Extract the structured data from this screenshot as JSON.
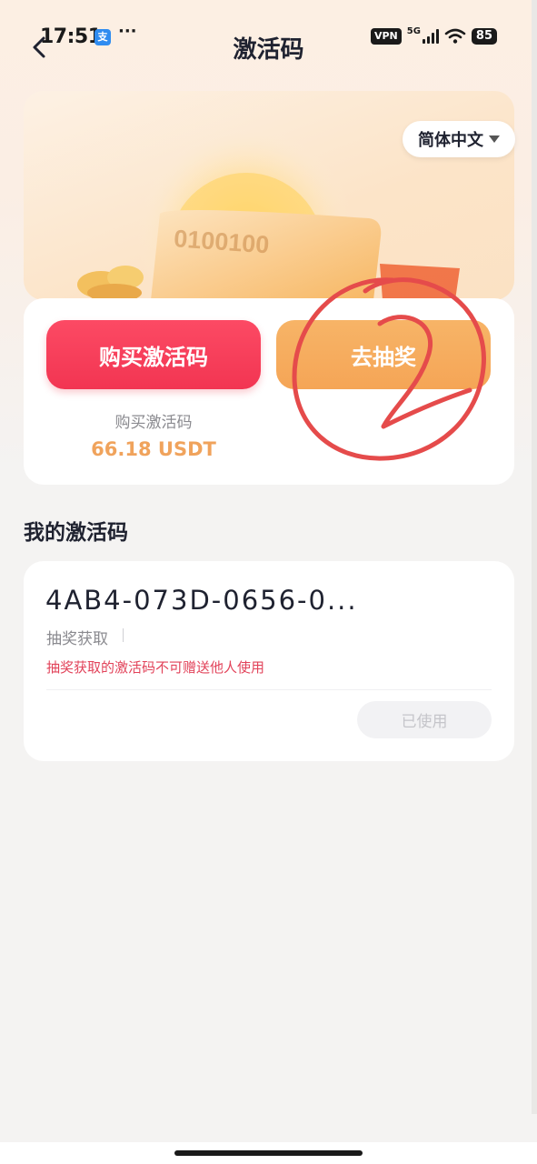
{
  "status_bar": {
    "time": "17:51",
    "app_badge": "支",
    "more": "···",
    "vpn": "VPN",
    "network": "5G",
    "battery": "85"
  },
  "header": {
    "title": "激活码"
  },
  "banner": {
    "code_art_text": "0100100",
    "language": "简体中文"
  },
  "actions": {
    "buy_label": "购买激活码",
    "lottery_label": "去抽奖",
    "price_label": "购买激活码",
    "price_value": "66.18 USDT"
  },
  "my_codes": {
    "section_title": "我的激活码",
    "items": [
      {
        "code": "4AB4-073D-0656-0...",
        "source": "抽奖获取",
        "warning": "抽奖获取的激活码不可赠送他人使用",
        "status": "已使用"
      }
    ]
  },
  "colors": {
    "buy_button": "#f23552",
    "lottery_button": "#f5a556",
    "price": "#f0a35c",
    "warning": "#e2435a",
    "annotation": "#e54b4b"
  }
}
